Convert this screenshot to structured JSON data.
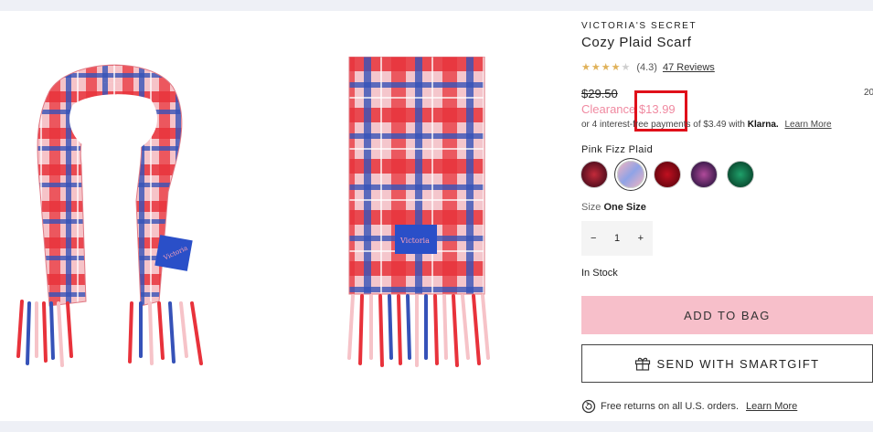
{
  "product": {
    "brand": "VICTORIA'S SECRET",
    "title": "Cozy Plaid Scarf",
    "rating": "(4.3)",
    "rating_value": 4.3,
    "reviews_link": "47 Reviews",
    "original_price": "$29.50",
    "sale_label": "Clearance",
    "sale_price": "$13.99",
    "right_edge_text": "20",
    "klarna_text": "or 4 interest-free payments of $3.49 with",
    "klarna_brand": "Klarna.",
    "klarna_learn_more": "Learn More",
    "color_name": "Pink Fizz Plaid",
    "size_label": "Size",
    "size_value": "One Size",
    "quantity": "1",
    "minus": "−",
    "plus": "+",
    "stock": "In Stock",
    "add_to_bag": "ADD TO BAG",
    "smartgift": "SEND WITH SMARTGIFT",
    "returns_text": "Free returns on all U.S. orders.",
    "returns_learn_more": "Learn More"
  },
  "colors": {
    "sale": "#f08aa1",
    "add_to_bag_bg": "#f7bfca",
    "highlight": "#e0101a",
    "swatches": [
      "#8b1a2b",
      "#d6d6f0",
      "#9a0d16",
      "#6a2a6a",
      "#0f6b47"
    ]
  },
  "icons": {
    "gift": "gift-icon",
    "returns": "returns-icon",
    "star": "star-icon"
  }
}
